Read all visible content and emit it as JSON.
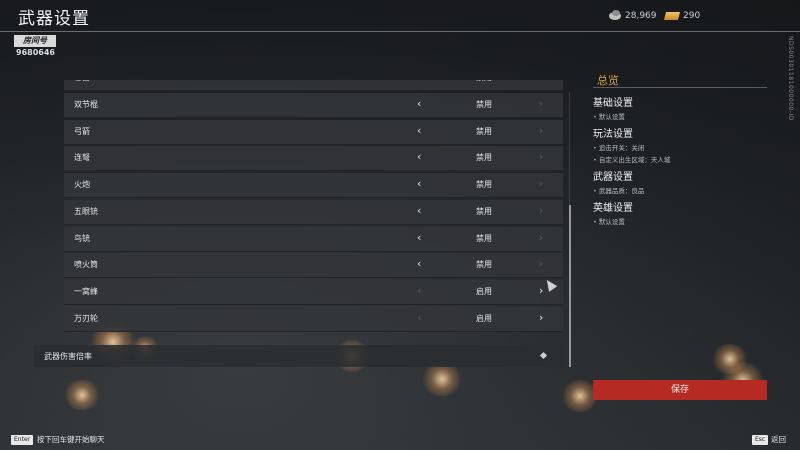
{
  "header": {
    "title": "武器设置",
    "room_label": "房间号",
    "room_id": "9680646",
    "silver": "28,969",
    "gold": "290",
    "side_code": "NDS00301181000000-ID"
  },
  "list": {
    "partial_row": {
      "name": "匕首",
      "value": "禁用"
    },
    "rows": [
      {
        "name": "双节棍",
        "value": "禁用",
        "left_enabled": true,
        "right_enabled": false
      },
      {
        "name": "弓箭",
        "value": "禁用",
        "left_enabled": true,
        "right_enabled": false
      },
      {
        "name": "连弩",
        "value": "禁用",
        "left_enabled": true,
        "right_enabled": false
      },
      {
        "name": "火炮",
        "value": "禁用",
        "left_enabled": true,
        "right_enabled": false
      },
      {
        "name": "五眼铳",
        "value": "禁用",
        "left_enabled": true,
        "right_enabled": false
      },
      {
        "name": "鸟铳",
        "value": "禁用",
        "left_enabled": true,
        "right_enabled": false
      },
      {
        "name": "喷火筒",
        "value": "禁用",
        "left_enabled": true,
        "right_enabled": false
      },
      {
        "name": "一窝蜂",
        "value": "启用",
        "left_enabled": false,
        "right_enabled": true
      },
      {
        "name": "万刃轮",
        "value": "启用",
        "left_enabled": false,
        "right_enabled": true
      }
    ],
    "multiplier_label": "武器伤害倍率"
  },
  "overview": {
    "title": "总览",
    "sections": [
      {
        "heading": "基础设置",
        "details": [
          "默认设置"
        ]
      },
      {
        "heading": "玩法设置",
        "details": [
          "追击开关：关闭",
          "自定义出生区域：天人城"
        ]
      },
      {
        "heading": "武器设置",
        "details": [
          "武器品质：良品"
        ]
      },
      {
        "heading": "英雄设置",
        "details": [
          "默认设置"
        ]
      }
    ]
  },
  "save_label": "保存",
  "footer": {
    "enter_key": "Enter",
    "enter_text": "按下回车键开始聊天",
    "esc_key": "Esc",
    "esc_text": "返回"
  },
  "colors": {
    "accent": "#e0a040",
    "save": "#b52a22"
  },
  "icons": {
    "left": "chevron-left-icon",
    "right": "chevron-right-icon",
    "silver": "coin-icon",
    "gold": "gold-bar-icon"
  }
}
